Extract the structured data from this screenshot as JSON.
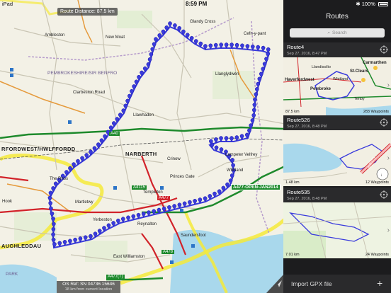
{
  "status": {
    "carrier": "iPad",
    "time": "8:59 PM",
    "battery": "100%"
  },
  "map": {
    "route_distance": "Route Distance: 87.5 km",
    "os_ref": "OS Ref: SN 04736 15646",
    "os_ref_sub": "18 km from current location",
    "labels": {
      "ambleston": "Ambleston",
      "new_moat": "New Moat",
      "glandy_cross": "Glandy Cross",
      "cefn_y_pant": "Cefn-y-pant",
      "pembrokeshire": "PEMBROKESHIRE/SIR BENFRO",
      "clarbeston_road": "Clarbeston Road",
      "llanglydwen": "Llanglydwen",
      "haverfordwest": "RFORDWEST/HWLFFORDD",
      "narberth": "NARBERTH",
      "whitland": "Whitland",
      "crinow": "Crinow",
      "princes_gate": "Princes Gate",
      "templeton": "Templeton",
      "the_rhos": "The Rhos",
      "yerbeston": "Yerbeston",
      "martletwy": "Martletwy",
      "hook": "Hook",
      "east_williamston": "East Williamston",
      "saundersfoot": "Saundersfoot",
      "tenby": "Tenby",
      "pembroke": "AUGHLEDDAU",
      "park": "PARK",
      "lampeter_velfrey": "Lampeter Velfrey",
      "llawhaden": "Llawhaden",
      "reynalton": "Reynalton",
      "amroth": "Amroth"
    },
    "roads": {
      "a40": "A40",
      "a478": "A478",
      "a4115": "A4115",
      "a477": "A477",
      "a477_sign": "A477-OPEN-JAN2014",
      "a477t": "A477(T)",
      "b4314": "B4314"
    }
  },
  "panel": {
    "title": "Routes",
    "search_placeholder": "Search",
    "routes": [
      {
        "name": "Route4",
        "date": "Sep 27, 2016, 8:47 PM",
        "distance": "87.5 km",
        "waypoints": "283 Waypoints",
        "thumb_labels": [
          "Carmarthen",
          "St.Clears",
          "Llandissilio",
          "Haverfordwest",
          "Pembroke",
          "Tenby",
          "Whitland"
        ]
      },
      {
        "name": "Route526",
        "date": "Sep 27, 2016, 8:48 PM",
        "distance": "1.48 km",
        "waypoints": "12 Waypoints",
        "thumb_labels": [
          "A4075"
        ]
      },
      {
        "name": "Route535",
        "date": "Sep 27, 2016, 8:48 PM",
        "distance": "7.01 km",
        "waypoints": "24 Waypoints",
        "thumb_labels": []
      }
    ],
    "import_label": "Import GPX file",
    "add_symbol": "+"
  },
  "colors": {
    "route": "#3a3bdc",
    "park_border": "#f5ea3a",
    "panel_bg": "#1c1c1e",
    "sea": "#a9d8ec",
    "green_road": "#1e8a2c",
    "red_road": "#d2232a"
  }
}
